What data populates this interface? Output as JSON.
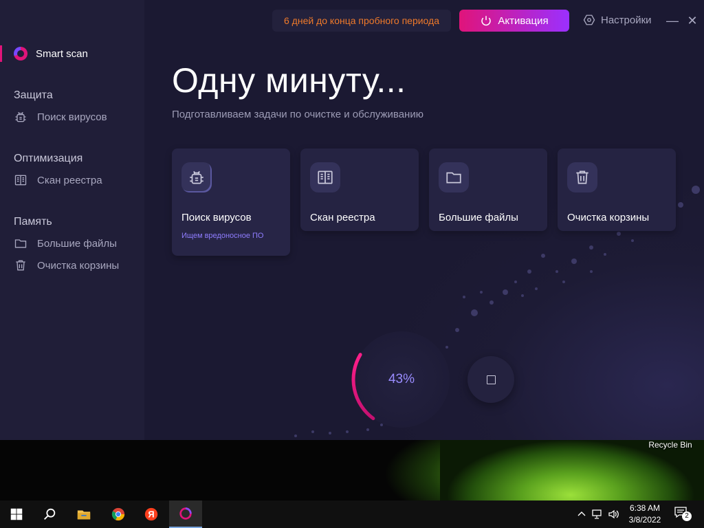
{
  "app": {
    "sidebar": {
      "smart_scan": "Smart scan",
      "sections": [
        {
          "title": "Защита",
          "items": [
            {
              "label": "Поиск вирусов",
              "icon": "bug-icon"
            }
          ]
        },
        {
          "title": "Оптимизация",
          "items": [
            {
              "label": "Скан реестра",
              "icon": "book-icon"
            }
          ]
        },
        {
          "title": "Память",
          "items": [
            {
              "label": "Большие файлы",
              "icon": "folder-icon"
            },
            {
              "label": "Очистка корзины",
              "icon": "trash-icon"
            }
          ]
        }
      ]
    },
    "header": {
      "trial_text": "6 дней до конца пробного периода",
      "activate_label": "Активация",
      "settings_label": "Настройки",
      "minimize_glyph": "—",
      "close_glyph": "✕"
    },
    "main": {
      "title": "Одну минуту...",
      "subtitle": "Подготавливаем задачи по очистке и обслуживанию",
      "cards": [
        {
          "label": "Поиск вирусов",
          "status": "Ищем вредоносное ПО",
          "icon": "bug-icon"
        },
        {
          "label": "Скан реестра",
          "icon": "book-icon"
        },
        {
          "label": "Большие файлы",
          "icon": "folder-icon"
        },
        {
          "label": "Очистка корзины",
          "icon": "trash-icon"
        }
      ],
      "progress_percent": 43,
      "progress_text": "43%"
    },
    "colors": {
      "accent_pink": "#e0147a",
      "accent_purple": "#9b30ff",
      "trial_orange": "#f07a2a",
      "status_violet": "#8f7dff"
    }
  },
  "desktop": {
    "recycle_bin_label": "Recycle Bin"
  },
  "taskbar": {
    "apps": [
      "start-icon",
      "search-icon",
      "file-explorer-icon",
      "chrome-icon",
      "yandex-browser-icon",
      "cleaner-app-icon"
    ],
    "yandex_glyph": "Я",
    "time": "6:38 AM",
    "date": "3/8/2022",
    "notification_count": "2"
  }
}
